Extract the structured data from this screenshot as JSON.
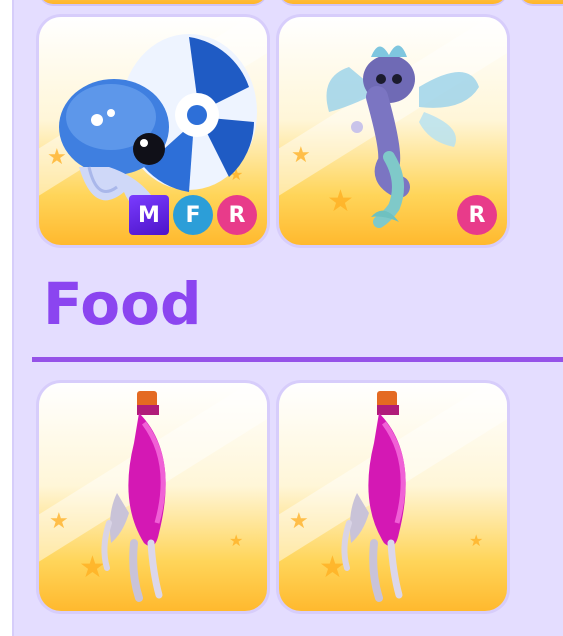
{
  "inventory": {
    "pets": [
      {
        "name": "nautilus-pet",
        "badges": [
          {
            "type": "mega",
            "label": "M"
          },
          {
            "type": "fly",
            "label": "F"
          },
          {
            "type": "ride",
            "label": "R"
          }
        ]
      },
      {
        "name": "seahorse-dragon-pet",
        "badges": [
          {
            "type": "ride",
            "label": "R"
          }
        ]
      }
    ],
    "food_section": {
      "title": "Food"
    },
    "food": [
      {
        "name": "potion-bottle"
      },
      {
        "name": "potion-bottle"
      }
    ]
  },
  "colors": {
    "panel_bg": "#e4ddff",
    "accent": "#8b45f0",
    "card_gold": "#ffb92e",
    "mega": "#6a2be8",
    "fly": "#2c9ed8",
    "ride": "#e83b8a"
  }
}
